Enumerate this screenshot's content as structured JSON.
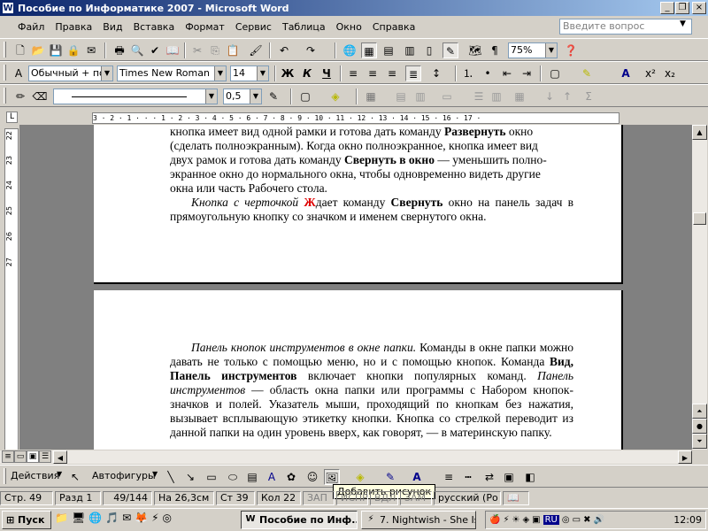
{
  "window": {
    "title": "Пособие по Информатике 2007  - Microsoft Word",
    "app_icon": "W"
  },
  "menu": {
    "items": [
      "Файл",
      "Правка",
      "Вид",
      "Вставка",
      "Формат",
      "Сервис",
      "Таблица",
      "Окно",
      "Справка"
    ],
    "ask_placeholder": "Введите вопрос"
  },
  "toolbar_standard": {
    "zoom": "75%"
  },
  "toolbar_format": {
    "style": "Обычный + по ц",
    "font": "Times New Roman",
    "size": "14",
    "bold": "Ж",
    "italic": "К",
    "underline": "Ч"
  },
  "toolbar_tables": {
    "line_weight": "0,5"
  },
  "ruler": {
    "text": "3 · 2 · 1 · · · 1 · 2 · 3 · 4 · 5 · 6 · 7 · 8 · 9 · 10 · 11 · 12 · 13 · 14 · 15 · 16 · 17 ·",
    "vertical": [
      "22",
      "23",
      "24",
      "25",
      "26",
      "27"
    ]
  },
  "document": {
    "page1": {
      "l1a": "кнопка имеет вид одной рамки  и готова дать команду ",
      "l1b": "Развернуть",
      " l1c": " окно",
      "l2": "(сделать полноэкранным). Когда окно полноэкранное, кнопка имеет вид",
      "l3a": "двух рамок и готова дать команду ",
      "l3b": "Свернуть в окно",
      "l3c": " — уменьшить полно-",
      "l4": "экранное окно до нормального окна, чтобы одновременно видеть другие",
      "l5": "окна или часть Рабочего стола.",
      "p2a": "Кнопка с черточкой ",
      "p2mark": "Ж",
      "p2b": "дает команду ",
      "p2c": "Свернуть",
      "p2d": " окно на панель задач в прямоугольную кнопку со значком и именем свернутого окна."
    },
    "page2": {
      "a": "Панель кнопок инструментов в окне папки.",
      "b": " Команды в окне папки можно давать не только с помощью меню, но и с помощью кнопок. Команда ",
      "c": "Вид, Панель инструментов",
      "d": " включает кнопки популярных команд. ",
      "e": "Панель инструментов",
      "f": " — область окна папки или программы с Набором кнопок-значков и полей. Указатель мыши, проходящий по кнопкам без нажатия, вызывает всплывающую этикетку кнопки. Кнопка со стрелкой переводит из данной папки на один уровень вверх, как говорят, — в материнскую папку."
    }
  },
  "drawing": {
    "actions": "Действия",
    "autoshapes": "Автофигуры",
    "tooltip": "Добавить рисунок"
  },
  "status": {
    "page": "Стр. 49",
    "section": "Разд 1",
    "pages": "49/144",
    "at": "На 26,3см",
    "line": "Ст 39",
    "col": "Кол 22",
    "rec": "ЗАП",
    "trk": "ИСПР",
    "ext": "ВДЛ",
    "ovr": "ЗАМ",
    "lang": "русский (Ро"
  },
  "taskbar": {
    "start": "Пуск",
    "tasks": [
      "Пособие по Инф...",
      "7. Nightwish - She Is..."
    ],
    "lang_indicator": "RU",
    "clock": "12:09"
  }
}
